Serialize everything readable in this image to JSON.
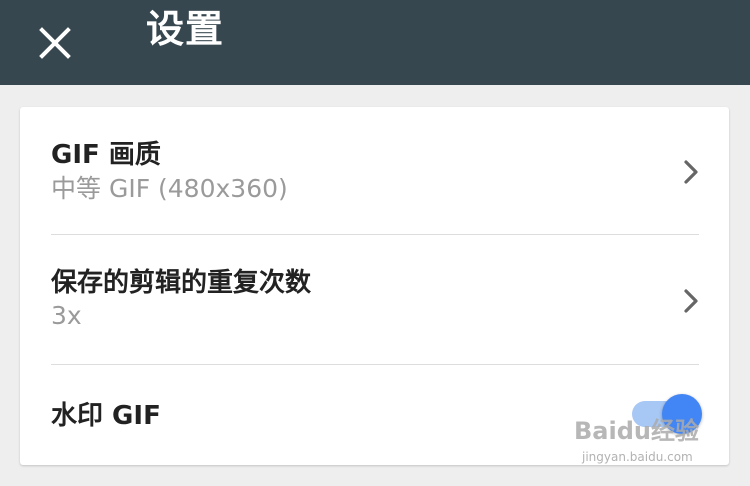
{
  "appbar": {
    "title": "设置",
    "close_icon": "close-icon",
    "background": "#37474f"
  },
  "settings": [
    {
      "title": "GIF 画质",
      "subtitle": "中等 GIF (480x360)",
      "icon": "chevron-right-icon"
    },
    {
      "title": "保存的剪辑的重复次数",
      "subtitle": "3x",
      "icon": "chevron-right-icon"
    },
    {
      "title": "水印 GIF",
      "toggle": {
        "state": "on",
        "color": "#4285f4"
      }
    }
  ],
  "watermark": {
    "logo": "Baidu经验",
    "url": "jingyan.baidu.com"
  }
}
